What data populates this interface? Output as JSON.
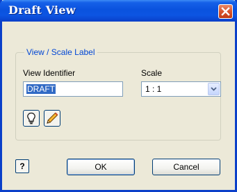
{
  "window": {
    "title": "Draft View"
  },
  "group": {
    "label": "View / Scale Label"
  },
  "fields": {
    "identifier_label": "View Identifier",
    "identifier_value": "DRAFT",
    "scale_label": "Scale",
    "scale_value": "1 : 1"
  },
  "tool_icons": [
    "lightbulb-icon",
    "pencil-icon"
  ],
  "buttons": {
    "help": "?",
    "ok": "OK",
    "cancel": "Cancel"
  },
  "colors": {
    "titlebar": "#0a52de",
    "close": "#d8532c",
    "group_label": "#0046d5",
    "selection": "#316ac5"
  }
}
